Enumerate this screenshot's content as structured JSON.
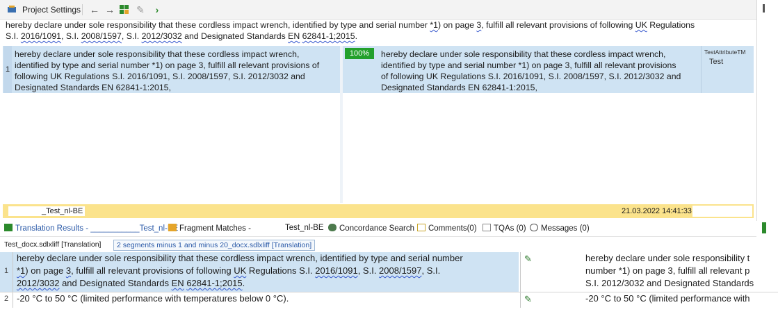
{
  "toolbar": {
    "title": "Project Settings",
    "icons": [
      "settings-icon",
      "arrow-left-icon",
      "arrow-right-icon",
      "grid-add-icon",
      "tools-icon",
      "chevron-right-icon"
    ]
  },
  "preview": {
    "line1_a": "hereby declare under sole responsibility that these cordless impact wrench, identified by type and serial number ",
    "line1_b": "*1",
    "line1_c": ") on page ",
    "line1_d": "3",
    "line1_e": ", fulfill all relevant provisions of following ",
    "line1_f": "UK",
    "line1_g": " Regulations",
    "line2_a": "S.I. ",
    "line2_b": "2016/1091",
    "line2_c": ", S.I. ",
    "line2_d": "2008/1597",
    "line2_e": ", S.I. ",
    "line2_f": "2012/3032",
    "line2_g": " and Designated Standards ",
    "line2_h": "EN",
    "line2_i": " ",
    "line2_j": "62841-1;2015",
    "line2_k": "."
  },
  "editor": {
    "segment_number": "1",
    "source_lines": [
      "hereby declare under sole responsibility that these cordless impact wrench,",
      "identified by type and serial number *1) on page 3, fulfill all relevant provisions of",
      "following UK Regulations S.I. 2016/1091, S.I. 2008/1597, S.I. 2012/3032 and",
      "Designated Standards EN 62841-1:2015,"
    ],
    "match_percent": "100%",
    "target_lines": [
      "hereby declare under sole responsibility that these cordless impact wrench,",
      "identified by type and serial number *1) on page 3, fulfill all relevant provisions",
      "of following UK Regulations S.I. 2016/1091, S.I. 2008/1597, S.I. 2012/3032 and",
      "Designated Standards EN 62841-1:2015,"
    ],
    "tm_attribute_name": "TestAttributeTM",
    "tm_attribute_value": "Test"
  },
  "status": {
    "file": "_Test_nl-BE",
    "datetime": "21.03.2022 14:41:33"
  },
  "tabs": {
    "translation_results": "Translation Results - ___________Test_nl-BE",
    "fragment_matches": "Fragment Matches -",
    "fragment_file": "Test_nl-BE",
    "concordance": "Concordance Search",
    "comments": "Comments(0)",
    "tqas": "TQAs (0)",
    "messages": "Messages (0)"
  },
  "doc_tabs": {
    "tab1": "Test_docx.sdlxliff [Translation]",
    "tab2": "2 segments minus 1 and minus 20_docx.sdlxliff [Translation]"
  },
  "results": {
    "rows": [
      {
        "num": "1",
        "src_line1": "hereby declare under sole responsibility that these cordless impact wrench, identified by type and serial number",
        "src_line2_a": "*1",
        "src_line2_b": ") on page ",
        "src_line2_c": "3",
        "src_line2_d": ", fulfill all relevant provisions of following ",
        "src_line2_e": "UK",
        "src_line2_f": " Regulations S.I. ",
        "src_line2_g": "2016/1091",
        "src_line2_h": ", S.I. ",
        "src_line2_i": "2008/1597",
        "src_line2_j": ", S.I.",
        "src_line3_a": "2012/3032",
        "src_line3_b": " and Designated Standards ",
        "src_line3_c": "EN",
        "src_line3_d": " ",
        "src_line3_e": "62841-1;2015",
        "src_line3_f": ".",
        "tgt_line1": "hereby declare under sole responsibility t",
        "tgt_line2": "number *1) on page 3, fulfill all relevant p",
        "tgt_line3": "S.I. 2012/3032 and Designated Standards"
      },
      {
        "num": "2",
        "src": "-20  °C to 50  °C (limited performance with temperatures below 0  °C).",
        "tgt": "-20 °C to 50 °C (limited performance with"
      }
    ]
  },
  "colors": {
    "selected_row": "#cfe3f3",
    "match_green": "#23a02c",
    "status_yellow": "#fbe38c",
    "link_blue": "#2b5aa8"
  }
}
